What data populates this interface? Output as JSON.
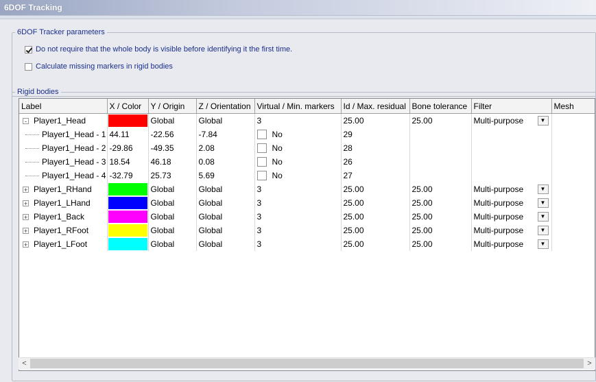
{
  "window": {
    "title": "6DOF Tracking"
  },
  "tracker_params": {
    "legend": "6DOF Tracker parameters",
    "options": [
      {
        "label": "Do not require that the whole body is visible before identifying it the first time.",
        "checked": true
      },
      {
        "label": "Calculate missing markers in rigid bodies",
        "checked": false
      }
    ]
  },
  "rigid_bodies": {
    "legend": "Rigid bodies",
    "columns": [
      "Label",
      "X / Color",
      "Y / Origin",
      "Z / Orientation",
      "Virtual / Min. markers",
      "Id / Max. residual",
      "Bone tolerance",
      "Filter",
      "Mesh"
    ],
    "rows": [
      {
        "expander": "-",
        "label": "Player1_Head",
        "color": "#ff0000",
        "y": "Global",
        "z": "Global",
        "virtual": "3",
        "id": "25.00",
        "bone": "25.00",
        "filter": "Multi-purpose"
      },
      {
        "child": true,
        "label": "Player1_Head - 1",
        "x": "44.11",
        "y": "-22.56",
        "z": "-7.84",
        "virtual": "No",
        "id": "29"
      },
      {
        "child": true,
        "label": "Player1_Head - 2",
        "x": "-29.86",
        "y": "-49.35",
        "z": "2.08",
        "virtual": "No",
        "id": "28"
      },
      {
        "child": true,
        "label": "Player1_Head - 3",
        "x": "18.54",
        "y": "46.18",
        "z": "0.08",
        "virtual": "No",
        "id": "26"
      },
      {
        "child": true,
        "label": "Player1_Head - 4",
        "x": "-32.79",
        "y": "25.73",
        "z": "5.69",
        "virtual": "No",
        "id": "27"
      },
      {
        "expander": "+",
        "label": "Player1_RHand",
        "color": "#00ff00",
        "y": "Global",
        "z": "Global",
        "virtual": "3",
        "id": "25.00",
        "bone": "25.00",
        "filter": "Multi-purpose"
      },
      {
        "expander": "+",
        "label": "Player1_LHand",
        "color": "#0000ff",
        "y": "Global",
        "z": "Global",
        "virtual": "3",
        "id": "25.00",
        "bone": "25.00",
        "filter": "Multi-purpose"
      },
      {
        "expander": "+",
        "label": "Player1_Back",
        "color": "#ff00ff",
        "y": "Global",
        "z": "Global",
        "virtual": "3",
        "id": "25.00",
        "bone": "25.00",
        "filter": "Multi-purpose"
      },
      {
        "expander": "+",
        "label": "Player1_RFoot",
        "color": "#ffff00",
        "y": "Global",
        "z": "Global",
        "virtual": "3",
        "id": "25.00",
        "bone": "25.00",
        "filter": "Multi-purpose"
      },
      {
        "expander": "+",
        "label": "Player1_LFoot",
        "color": "#00ffff",
        "y": "Global",
        "z": "Global",
        "virtual": "3",
        "id": "25.00",
        "bone": "25.00",
        "filter": "Multi-purpose"
      }
    ]
  },
  "scrollbar": {
    "left_arrow": "<",
    "right_arrow": ">"
  }
}
